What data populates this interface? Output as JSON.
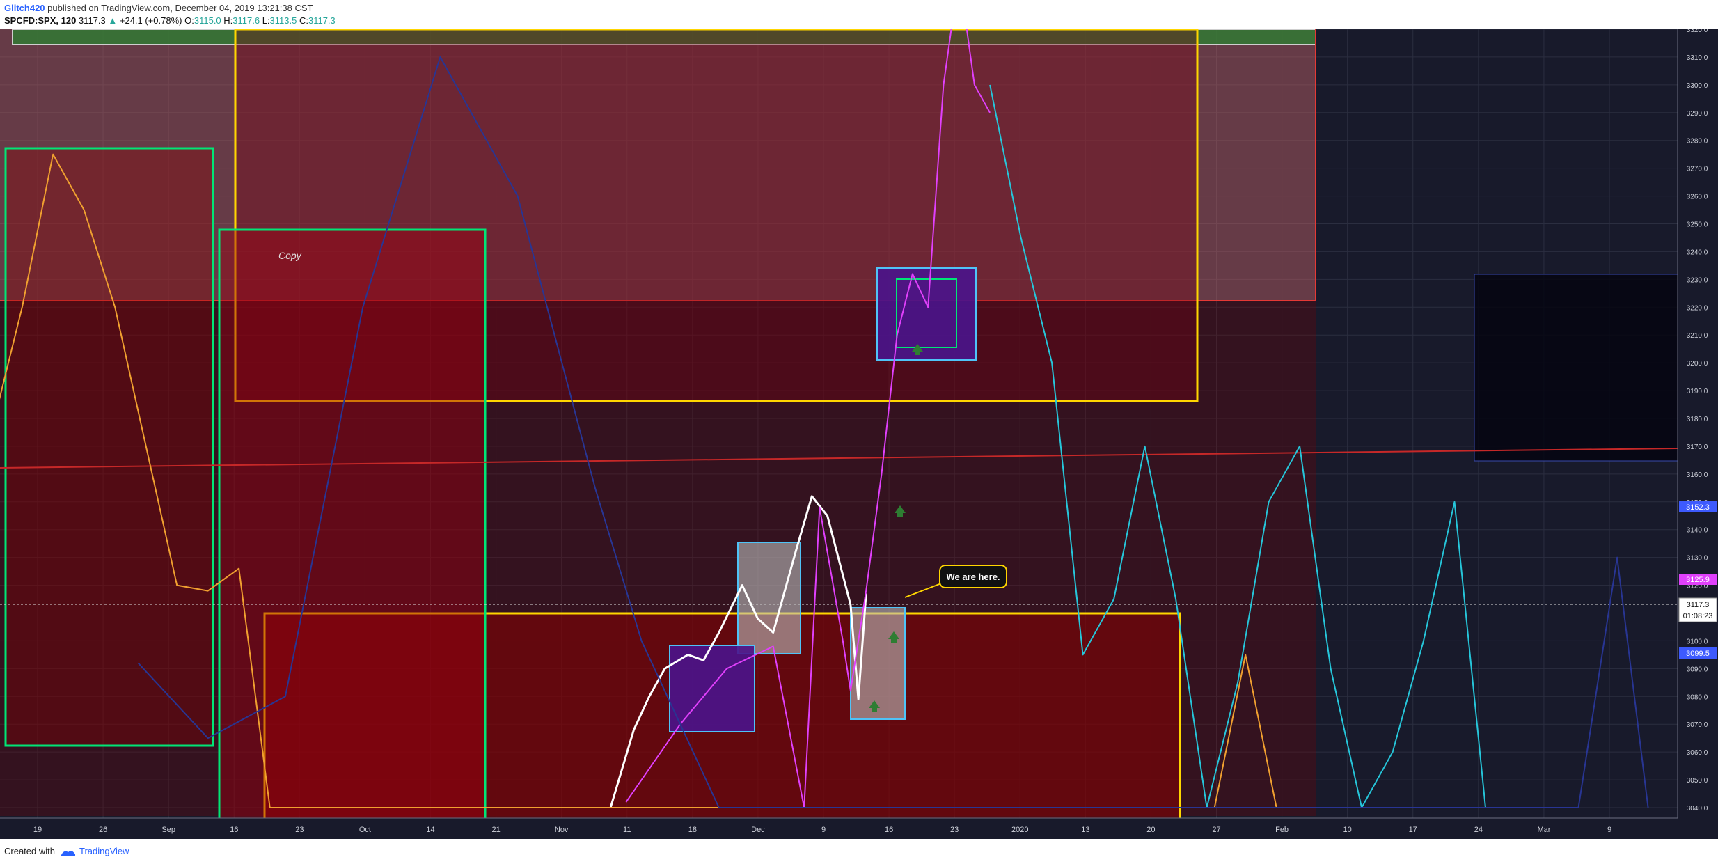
{
  "header": {
    "user": "Glitch420",
    "published_text": " published on TradingView.com, December 04, 2019 13:21:38 CST",
    "symbol": "SPCFD:SPX, 120",
    "last": "3117.3",
    "change": "+24.1 (+0.78%)",
    "o_label": "O:",
    "o": "3115.0",
    "h_label": "H:",
    "h": "3117.6",
    "l_label": "L:",
    "l": "3113.5",
    "c_label": "C:",
    "c": "3117.3"
  },
  "annotations": {
    "copy": "Copy",
    "callout": "We are here."
  },
  "price_badges": {
    "upper": "3152.3",
    "magenta": "3125.9",
    "current": "3117.3",
    "countdown": "01:08:23",
    "lower": "3099.5"
  },
  "footer": {
    "created_with": "Created with",
    "brand": "TradingView"
  },
  "colors": {
    "background": "#181a2b",
    "grid": "#2b2e40",
    "white_price": "#ffffff",
    "cyan_fractal": "#26c6da",
    "magenta_fractal": "#e040fb",
    "orange_fractal": "#f0a030",
    "navy_fractal": "#283593",
    "red_zone": "#b71c1c",
    "yellow_box": "#ffd600",
    "green_box": "#00e676"
  },
  "chart_data": {
    "type": "line",
    "title": "SPCFD:SPX, 120",
    "y_axis": {
      "min": 3040,
      "max": 3320,
      "step": 10,
      "ticks": [
        "3040.0",
        "3050.0",
        "3060.0",
        "3070.0",
        "3080.0",
        "3090.0",
        "3100.0",
        "3110.0",
        "3120.0",
        "3130.0",
        "3140.0",
        "3150.0",
        "3160.0",
        "3170.0",
        "3180.0",
        "3190.0",
        "3200.0",
        "3210.0",
        "3220.0",
        "3230.0",
        "3240.0",
        "3250.0",
        "3260.0",
        "3270.0",
        "3280.0",
        "3290.0",
        "3300.0",
        "3310.0",
        "3320.0"
      ]
    },
    "x_axis": {
      "ticks": [
        "19",
        "26",
        "Sep",
        "16",
        "23",
        "Oct",
        "14",
        "21",
        "Nov",
        "11",
        "18",
        "Dec",
        "9",
        "16",
        "23",
        "2020",
        "13",
        "20",
        "27",
        "Feb",
        "10",
        "17",
        "24",
        "Mar",
        "9"
      ]
    },
    "series": [
      {
        "role": "price",
        "color": "#ffffff",
        "x": [
          "2019-11-01",
          "2019-11-04",
          "2019-11-06",
          "2019-11-08",
          "2019-11-11",
          "2019-11-13",
          "2019-11-15",
          "2019-11-18",
          "2019-11-20",
          "2019-11-22",
          "2019-11-25",
          "2019-11-27",
          "2019-11-29",
          "2019-12-02",
          "2019-12-03",
          "2019-12-04"
        ],
        "values": [
          3040,
          3068,
          3080,
          3090,
          3095,
          3093,
          3103,
          3120,
          3108,
          3103,
          3133,
          3152,
          3145,
          3113,
          3079,
          3117
        ]
      },
      {
        "role": "fractal",
        "color": "#e040fb",
        "x": [
          "2019-11-03",
          "2019-11-10",
          "2019-11-16",
          "2019-11-22",
          "2019-11-26",
          "2019-11-28",
          "2019-12-01",
          "2019-12-02",
          "2019-12-04",
          "2019-12-06",
          "2019-12-08",
          "2019-12-10",
          "2019-12-12",
          "2019-12-14",
          "2019-12-16",
          "2019-12-18",
          "2019-12-20"
        ],
        "values": [
          3042,
          3070,
          3090,
          3098,
          3040,
          3148,
          3100,
          3082,
          3118,
          3160,
          3210,
          3232,
          3220,
          3300,
          3340,
          3300,
          3290
        ]
      },
      {
        "role": "fractal",
        "color": "#26c6da",
        "x": [
          "2019-12-20",
          "2019-12-24",
          "2019-12-28",
          "2020-01-01",
          "2020-01-05",
          "2020-01-09",
          "2020-01-13",
          "2020-01-17",
          "2020-01-21",
          "2020-01-25",
          "2020-01-29",
          "2020-02-02",
          "2020-02-06",
          "2020-02-10",
          "2020-02-14",
          "2020-02-18",
          "2020-02-22"
        ],
        "values": [
          3300,
          3245,
          3200,
          3095,
          3115,
          3170,
          3115,
          3040,
          3085,
          3150,
          3170,
          3090,
          3040,
          3060,
          3100,
          3150,
          3040
        ]
      },
      {
        "role": "fractal",
        "color": "#f0a030",
        "x": [
          "2019-08-13",
          "2019-08-17",
          "2019-08-21",
          "2019-08-25",
          "2019-08-29",
          "2019-09-02",
          "2019-09-06",
          "2019-09-10",
          "2019-09-14",
          "2019-09-18",
          "2020-01-18",
          "2020-01-22",
          "2020-01-26"
        ],
        "values": [
          3175,
          3220,
          3275,
          3255,
          3220,
          3170,
          3120,
          3118,
          3126,
          3040,
          3040,
          3095,
          3040
        ]
      },
      {
        "role": "fractal",
        "color": "#283593",
        "x": [
          "2019-09-01",
          "2019-09-10",
          "2019-09-20",
          "2019-09-30",
          "2019-10-10",
          "2019-10-20",
          "2019-10-30",
          "2019-11-05",
          "2019-11-15",
          "2020-03-05",
          "2020-03-10",
          "2020-03-14"
        ],
        "values": [
          3092,
          3065,
          3080,
          3220,
          3310,
          3260,
          3155,
          3100,
          3040,
          3040,
          3130,
          3040
        ]
      }
    ]
  }
}
